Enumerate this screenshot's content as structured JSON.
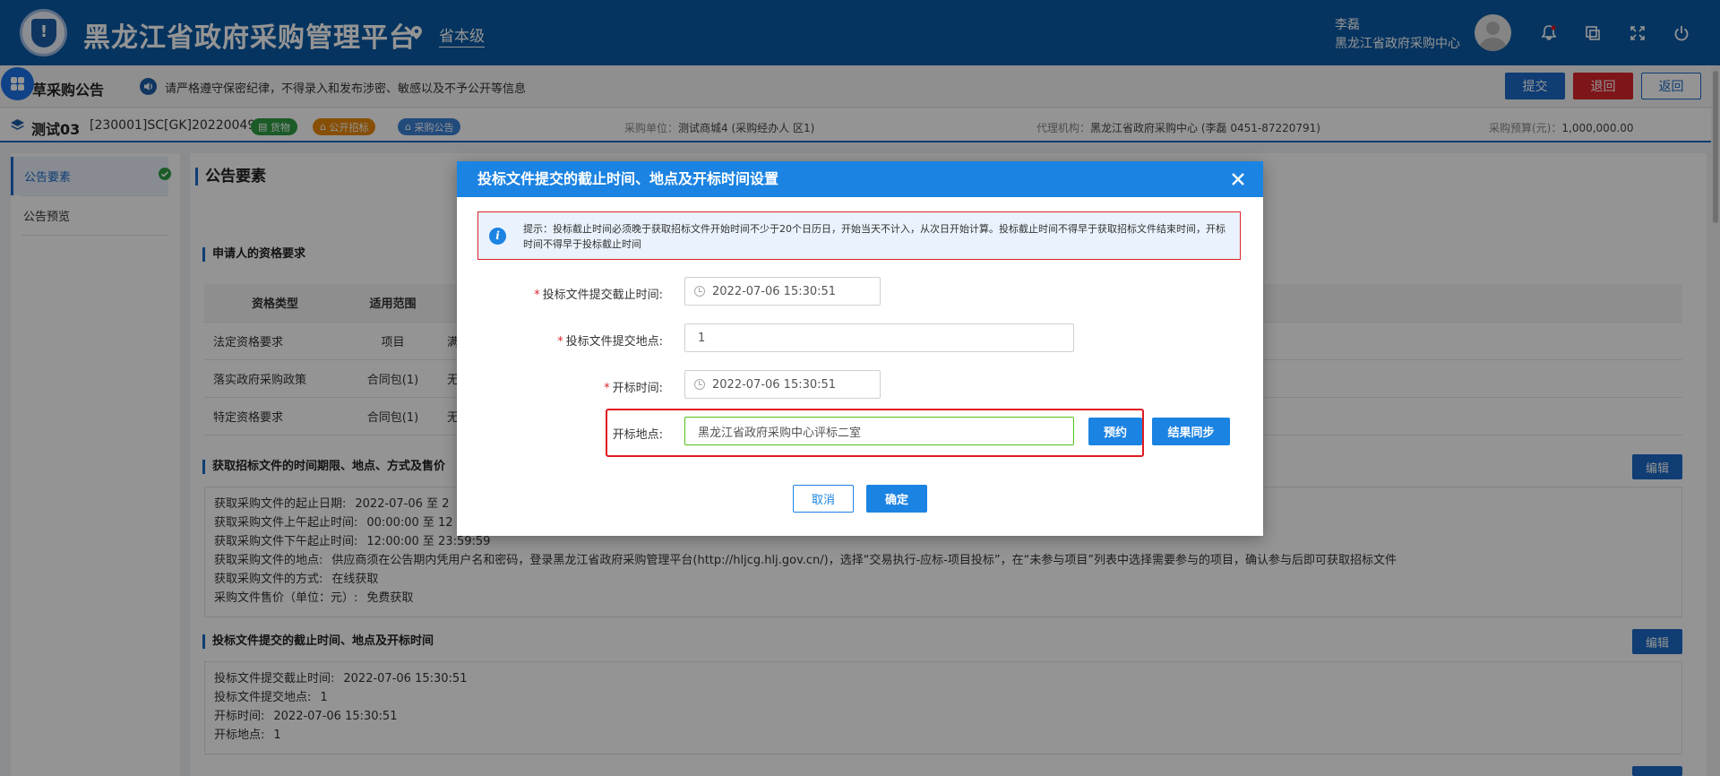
{
  "header": {
    "app_title": "黑龙江省政府采购管理平台",
    "location": "省本级",
    "user_name": "李磊",
    "user_org": "黑龙江省政府采购中心"
  },
  "subbar": {
    "page_title": "草采购公告",
    "notice": "请严格遵守保密纪律，不得录入和发布涉密、敏感以及不予公开等信息",
    "submit_label": "提交",
    "reject_label": "退回",
    "back_label": "返回"
  },
  "project": {
    "name": "测试03",
    "code": "[230001]SC[GK]20220049",
    "tags": [
      "货物",
      "公开招标",
      "采购公告"
    ],
    "purchaser_label": "采购单位：",
    "purchaser_value": "测试商城4 (采购经办人 区1)",
    "agency_label": "代理机构：",
    "agency_value": "黑龙江省政府采购中心 (李磊 0451-87220791)",
    "budget_label": "采购预算(元)：",
    "budget_value": "1,000,000.00"
  },
  "sidebar": {
    "items": [
      {
        "label": "公告要素"
      },
      {
        "label": "公告预览"
      }
    ]
  },
  "main": {
    "title": "公告要素",
    "qual_section_title": "申请人的资格要求",
    "qual_table": {
      "headers": [
        "资格类型",
        "适用范围",
        ""
      ],
      "rows": [
        [
          "法定资格要求",
          "项目",
          "满"
        ],
        [
          "落实政府采购政策",
          "合同包(1)",
          "无"
        ],
        [
          "特定资格要求",
          "合同包(1)",
          "无"
        ]
      ]
    },
    "obtain_section_title": "获取招标文件的时间期限、地点、方式及售价",
    "edit_label": "编辑",
    "obtain_lines": [
      {
        "label": "获取采购文件的起止日期:",
        "value": "2022-07-06 至 2"
      },
      {
        "label": "获取采购文件上午起止时间:",
        "value": "00:00:00 至 12"
      },
      {
        "label": "获取采购文件下午起止时间:",
        "value": "12:00:00 至 23:59:59"
      },
      {
        "label": "获取采购文件的地点:",
        "value": "供应商须在公告期内凭用户名和密码，登录黑龙江省政府采购管理平台(http://hljcg.hlj.gov.cn/)，选择“交易执行-应标-项目投标”，在“未参与项目”列表中选择需要参与的项目，确认参与后即可获取招标文件"
      },
      {
        "label": "获取采购文件的方式:",
        "value": "在线获取"
      },
      {
        "label": "采购文件售价（单位：元）:",
        "value": "免费获取"
      }
    ],
    "deadline_section_title": "投标文件提交的截止时间、地点及开标时间",
    "deadline_lines": [
      {
        "label": "投标文件提交截止时间:",
        "value": "2022-07-06 15:30:51"
      },
      {
        "label": "投标文件提交地点:",
        "value": "1"
      },
      {
        "label": "开标时间:",
        "value": "2022-07-06 15:30:51"
      },
      {
        "label": "开标地点:",
        "value": "1"
      }
    ]
  },
  "modal": {
    "title": "投标文件提交的截止时间、地点及开标时间设置",
    "tip": "提示：投标截止时间必须晚于获取招标文件开始时间不少于20个日历日，开始当天不计入，从次日开始计算。投标截止时间不得早于获取招标文件结束时间，开标时间不得早于投标截止时间",
    "fields": {
      "deadline_label": "投标文件提交截止时间:",
      "deadline_value": "2022-07-06 15:30:51",
      "place_label": "投标文件提交地点:",
      "place_value": "1",
      "open_time_label": "开标时间:",
      "open_time_value": "2022-07-06 15:30:51",
      "open_place_label": "开标地点:",
      "open_place_value": "黑龙江省政府采购中心评标二室"
    },
    "reserve_label": "预约",
    "sync_label": "结果同步",
    "cancel_label": "取消",
    "confirm_label": "确定"
  },
  "colors": {
    "header_bg": "#0c5aa6",
    "primary": "#1b6ac9",
    "modal_head": "#1b83e2",
    "danger": "#d9252b",
    "success": "#2f9e44",
    "warning": "#e8890c"
  }
}
